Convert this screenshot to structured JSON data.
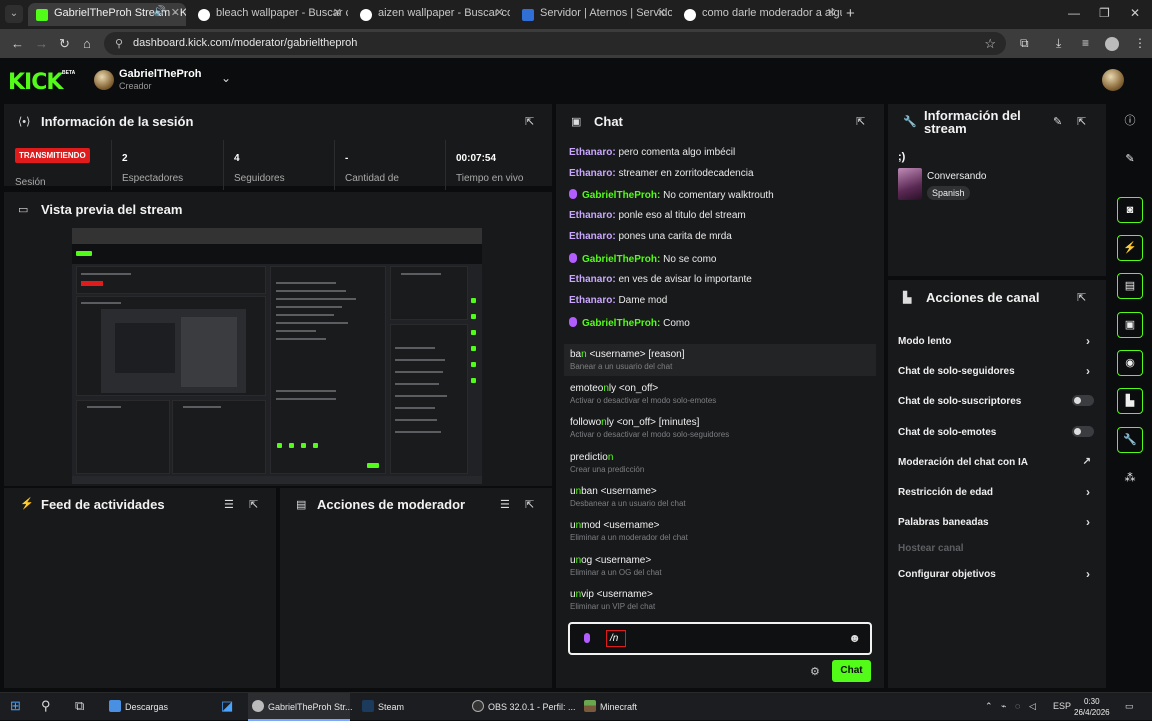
{
  "browser": {
    "tabs": [
      {
        "title": "GabrielTheProh Stream - Kick",
        "active": true
      },
      {
        "title": "bleach wallpaper - Buscar con G",
        "active": false
      },
      {
        "title": "aizen wallpaper - Buscar con G",
        "active": false
      },
      {
        "title": "Servidor | Aternos | Servidor de",
        "active": false
      },
      {
        "title": "como darle moderador a alguien",
        "active": false
      }
    ],
    "url": "dashboard.kick.com/moderator/gabrieltheproh"
  },
  "header": {
    "logo": "KICK",
    "logo_badge": "BETA",
    "channel_name": "GabrielTheProh",
    "channel_role": "Creador"
  },
  "session": {
    "title": "Información de la sesión",
    "live_badge": "TRANSMITIENDO",
    "session_label": "Sesión",
    "stats": [
      {
        "value": "2",
        "label": "Espectadores"
      },
      {
        "value": "4",
        "label": "Seguidores"
      },
      {
        "value": "-",
        "label": "Cantidad de"
      },
      {
        "value": "00:07:54",
        "label": "Tiempo en vivo"
      }
    ]
  },
  "preview": {
    "title": "Vista previa del stream"
  },
  "feed": {
    "title": "Feed de actividades"
  },
  "mod_actions": {
    "title": "Acciones de moderador"
  },
  "chat": {
    "title": "Chat",
    "messages": [
      {
        "user": "Ethanaro:",
        "text": "pero comenta algo imbécil",
        "badge": false
      },
      {
        "user": "Ethanaro:",
        "text": "streamer en zorritodecadencia",
        "badge": false
      },
      {
        "user": "GabrielTheProh:",
        "text": "No comentary walktrouth",
        "badge": true
      },
      {
        "user": "Ethanaro:",
        "text": "ponle eso al titulo del stream",
        "badge": false
      },
      {
        "user": "Ethanaro:",
        "text": "pones una carita de mrda",
        "badge": false
      },
      {
        "user": "GabrielTheProh:",
        "text": "No se como",
        "badge": true
      },
      {
        "user": "Ethanaro:",
        "text": "en ves de avisar lo importante",
        "badge": false
      },
      {
        "user": "Ethanaro:",
        "text": "Dame mod",
        "badge": false
      },
      {
        "user": "GabrielTheProh:",
        "text": "Como",
        "badge": true
      }
    ],
    "commands": [
      {
        "pre": "ba",
        "hl": "n",
        "rest": " <username> [reason]",
        "desc": "Banear a un usuario del chat"
      },
      {
        "pre": "emoteo",
        "hl": "n",
        "rest": "ly <on_off>",
        "desc": "Activar o desactivar el modo solo-emotes"
      },
      {
        "pre": "followo",
        "hl": "n",
        "rest": "ly <on_off> [minutes]",
        "desc": "Activar o desactivar el modo solo-seguidores"
      },
      {
        "pre": "predictio",
        "hl": "n",
        "rest": "",
        "desc": "Crear una predicción"
      },
      {
        "pre": "u",
        "hl": "n",
        "rest": "ban <username>",
        "desc": "Desbanear a un usuario del chat"
      },
      {
        "pre": "u",
        "hl": "n",
        "rest": "mod <username>",
        "desc": "Eliminar a un moderador del chat"
      },
      {
        "pre": "u",
        "hl": "n",
        "rest": "og <username>",
        "desc": "Eliminar a un OG del chat"
      },
      {
        "pre": "u",
        "hl": "n",
        "rest": "vip <username>",
        "desc": "Eliminar un VIP del chat"
      }
    ],
    "input_value": "/n",
    "send_label": "Chat"
  },
  "stream_info": {
    "title": "Información del stream",
    "stream_title": ";)",
    "category": "Conversando",
    "language": "Spanish"
  },
  "channel_actions": {
    "title": "Acciones de canal",
    "items": [
      {
        "label": "Modo lento",
        "control": "chevron"
      },
      {
        "label": "Chat de solo-seguidores",
        "control": "chevron"
      },
      {
        "label": "Chat de solo-suscriptores",
        "control": "toggle"
      },
      {
        "label": "Chat de solo-emotes",
        "control": "toggle"
      },
      {
        "label": "Moderación del chat con IA",
        "control": "external"
      },
      {
        "label": "Restricción de edad",
        "control": "chevron"
      },
      {
        "label": "Palabras baneadas",
        "control": "chevron"
      },
      {
        "label": "Hostear canal",
        "control": "disabled"
      },
      {
        "label": "Configurar objetivos",
        "control": "chevron"
      }
    ]
  },
  "taskbar": {
    "apps": [
      {
        "label": "Descargas"
      },
      {
        "label": "GabrielTheProh Str..."
      },
      {
        "label": "Steam"
      },
      {
        "label": "OBS 32.0.1 - Perfil: ..."
      },
      {
        "label": "Minecraft"
      }
    ],
    "lang": "ESP",
    "time": "0:30",
    "date": "26/4/2026"
  },
  "colors": {
    "accent": "#53fc18",
    "live": "#e01b1b",
    "panel": "#18191b",
    "background": "#0b0c0d"
  }
}
